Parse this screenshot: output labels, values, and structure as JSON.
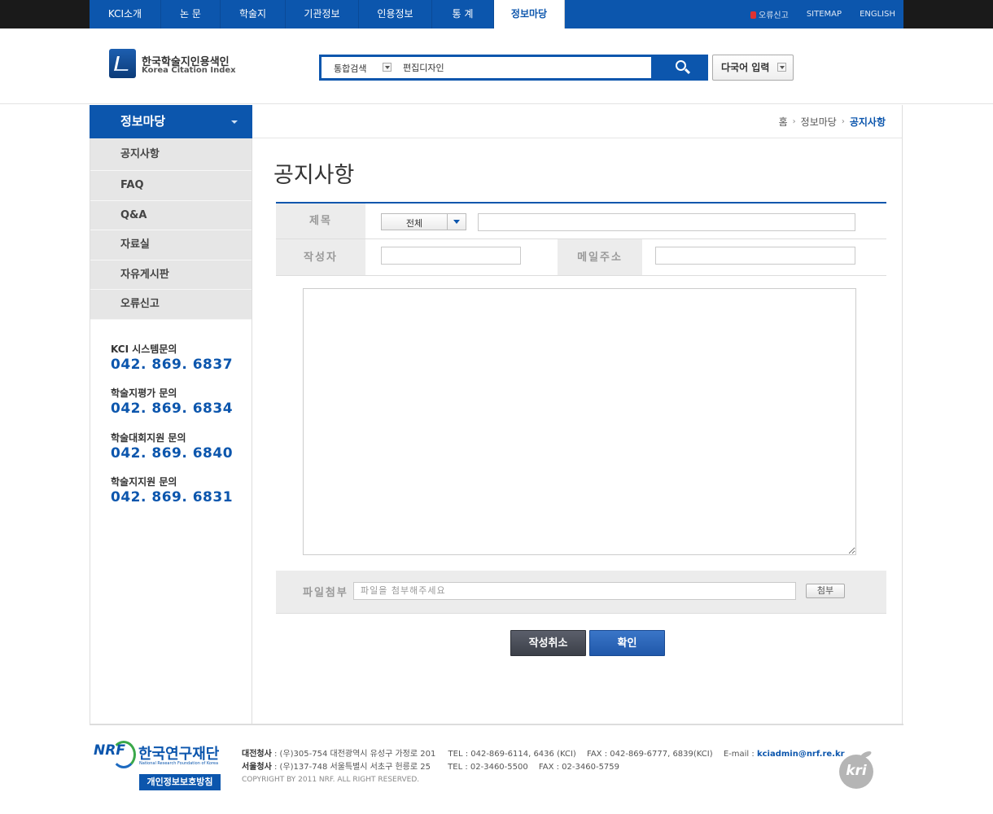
{
  "gnb": {
    "items": [
      {
        "label": "KCI소개"
      },
      {
        "label": "논 문"
      },
      {
        "label": "학술지"
      },
      {
        "label": "기관정보"
      },
      {
        "label": "인용정보"
      },
      {
        "label": "통 계"
      },
      {
        "label": "정보마당",
        "active": true
      }
    ],
    "util": {
      "error_report": "오류신고",
      "sitemap": "SITEMAP",
      "english": "ENGLISH"
    }
  },
  "header": {
    "logo_ko": "한국학술지인용색인",
    "logo_en": "Korea Citation Index",
    "search_scope": "통합검색",
    "search_value": "편집디자인",
    "multi_lang": "다국어 입력"
  },
  "lnb": {
    "title": "정보마당",
    "items": [
      "공지사항",
      "FAQ",
      "Q&A",
      "자료실",
      "자유게시판",
      "오류신고"
    ],
    "contacts": [
      {
        "label": "KCI 시스템문의",
        "number": "042. 869. 6837"
      },
      {
        "label": "학술지평가 문의",
        "number": "042. 869. 6834"
      },
      {
        "label": "학술대회지원 문의",
        "number": "042. 869. 6840"
      },
      {
        "label": "학술지지원 문의",
        "number": "042. 869. 6831"
      }
    ]
  },
  "breadcrumb": {
    "home": "홈",
    "section": "정보마당",
    "current": "공지사항"
  },
  "page_title": "공지사항",
  "form": {
    "subject_label": "제목",
    "subject_select": "전체",
    "subject_value": "",
    "author_label": "작성자",
    "author_value": "",
    "email_label": "메일주소",
    "email_value": "",
    "body_value": "",
    "file_label": "파일첨부",
    "file_placeholder": "파일을 첨부해주세요",
    "attach_btn": "첨부",
    "cancel_btn": "작성취소",
    "ok_btn": "확인"
  },
  "footer": {
    "nrf_mark": "NRF",
    "nrf_ko": "한국연구재단",
    "nrf_en": "National Research Foundation of Korea",
    "privacy": "개인정보보호방침",
    "daejeon_label": "대전청사",
    "daejeon_addr": " : (우)305-754 대전광역시 유성구 가정로 201",
    "daejeon_tel": "TEL : 042-869-6114, 6436 (KCI)",
    "daejeon_fax": "FAX : 042-869-6777, 6839(KCI)",
    "email_label": "E-mail :",
    "email": "kciadmin@nrf.re.kr",
    "seoul_label": "서울청사",
    "seoul_addr": " : (우)137-748 서울특별시 서초구 헌릉로 25",
    "seoul_tel": "TEL : 02-3460-5500",
    "seoul_fax": "FAX : 02-3460-5759",
    "copyright": "COPYRIGHT BY 2011 NRF. ALL RIGHT RESERVED.",
    "kri": "kri"
  }
}
